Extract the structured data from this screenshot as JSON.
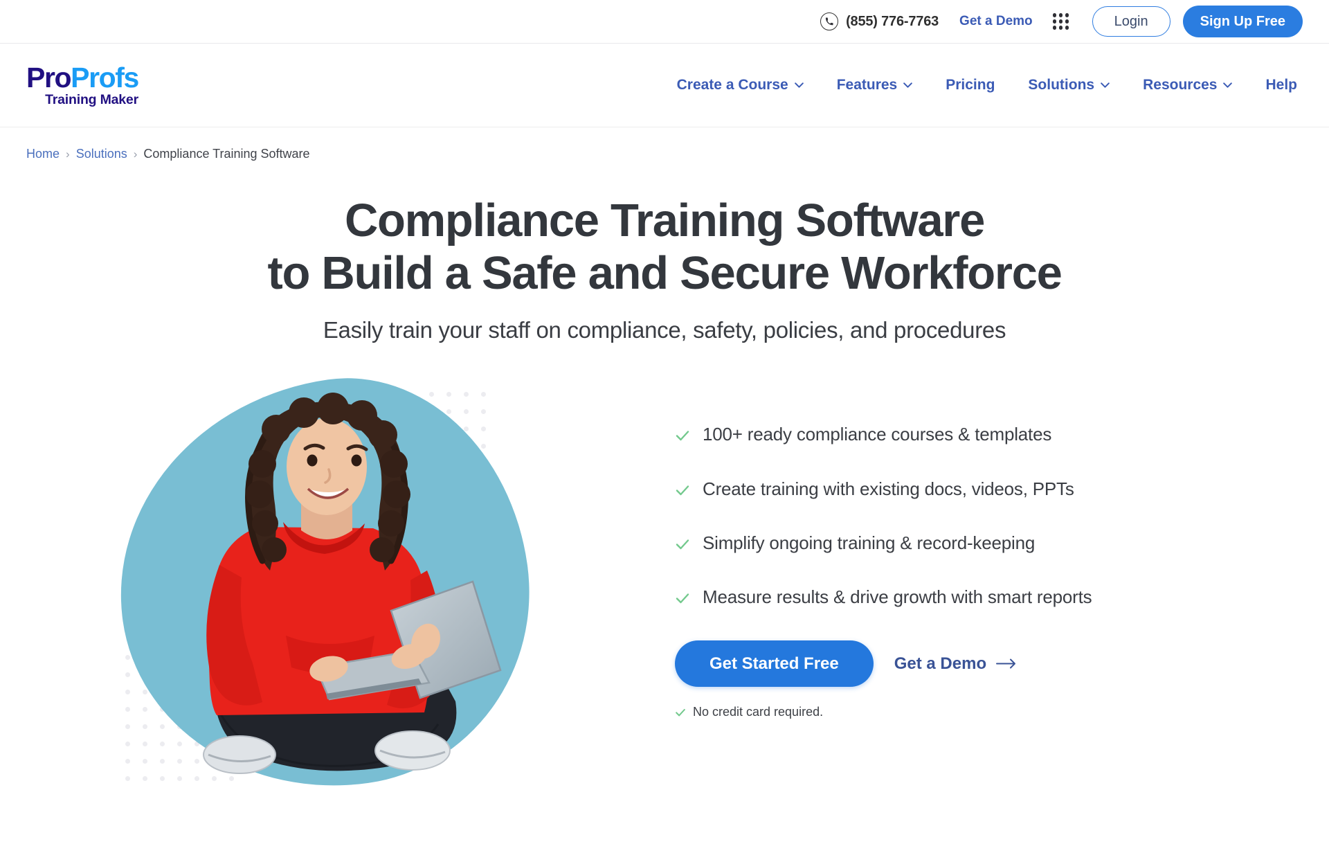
{
  "topbar": {
    "phone_icon": "phone-icon",
    "phone": "(855) 776-7763",
    "get_a_demo": "Get a Demo",
    "apps_icon": "apps-grid-icon",
    "login": "Login",
    "signup": "Sign Up Free",
    "signup_color": "#2b7de0",
    "login_border_color": "#2e7ce0"
  },
  "logo": {
    "part1": "Pro",
    "part2": "Profs",
    "subtitle": "Training Maker",
    "part1_color": "#211082",
    "part2_color": "#1a9cf5"
  },
  "nav": {
    "items": [
      {
        "label": "Create a Course",
        "caret": "chevron-down-icon",
        "has_caret": true
      },
      {
        "label": "Features",
        "caret": "chevron-down-icon",
        "has_caret": true
      },
      {
        "label": "Pricing",
        "has_caret": false
      },
      {
        "label": "Solutions",
        "caret": "chevron-down-icon",
        "has_caret": true
      },
      {
        "label": "Resources",
        "caret": "chevron-down-icon",
        "has_caret": true
      },
      {
        "label": "Help",
        "has_caret": false
      }
    ],
    "link_color": "#3b5bb5"
  },
  "breadcrumb": {
    "home": "Home",
    "sep1": "›",
    "solutions": "Solutions",
    "sep2": "›",
    "current": "Compliance Training Software"
  },
  "hero": {
    "headline_line1": "Compliance Training Software",
    "headline_line2": "to Build a Safe and Secure Workforce",
    "subtitle": "Easily train your staff on compliance, safety, policies, and procedures",
    "image_alt": "woman-with-laptop-illustration",
    "blob_color": "#79bed3",
    "dot_color": "#ececf0",
    "bullets": [
      {
        "icon": "check-icon",
        "text": "100+ ready compliance courses & templates"
      },
      {
        "icon": "check-icon",
        "text": "Create training with existing docs, videos, PPTs"
      },
      {
        "icon": "check-icon",
        "text": "Simplify ongoing training & record-keeping"
      },
      {
        "icon": "check-icon",
        "text": "Measure results & drive growth with smart reports"
      }
    ],
    "check_color": "#73c98d",
    "cta_primary": "Get Started Free",
    "cta_primary_color": "#2478dd",
    "cta_secondary": "Get a Demo",
    "cta_secondary_icon": "arrow-right-icon",
    "no_credit": "No credit card required."
  }
}
